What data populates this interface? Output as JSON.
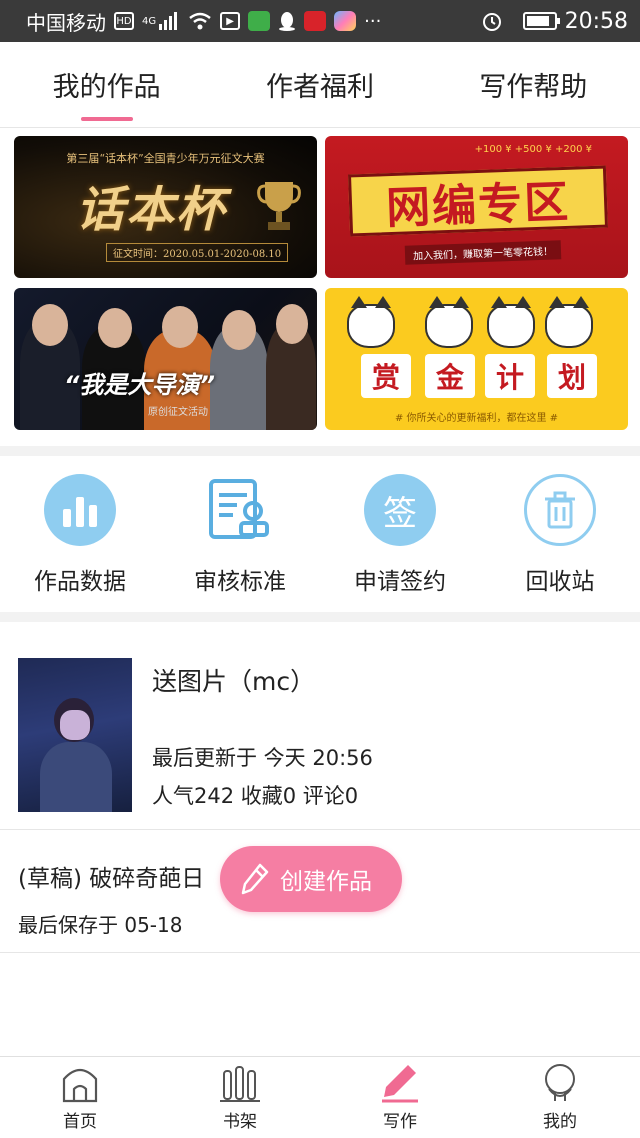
{
  "status_bar": {
    "carrier": "中国移动",
    "network": "4G",
    "hd": "HD",
    "time": "20:58",
    "icons": [
      "hd-icon",
      "signal-icon",
      "wifi-icon",
      "media-icon",
      "wechat-icon",
      "qq-icon",
      "app-icon",
      "app-icon",
      "more-icon",
      "alarm-icon",
      "battery-icon"
    ]
  },
  "tabs": [
    {
      "label": "我的作品",
      "active": true
    },
    {
      "label": "作者福利",
      "active": false
    },
    {
      "label": "写作帮助",
      "active": false
    }
  ],
  "banners": {
    "b1": {
      "headline": "第三届“话本杯”全国青少年万元征文大赛",
      "title": "话本杯",
      "date": "征文时间：2020.05.01-2020-08.10"
    },
    "b2": {
      "title": "网编专区",
      "money": "+100 ¥  +500 ¥  +200 ¥",
      "slogan": "加入我们，赚取第一笔零花钱！"
    },
    "b3": {
      "title": "“我是大导演”",
      "subtitle": "原创征文活动"
    },
    "b4": {
      "chars": [
        "赏",
        "金",
        "计",
        "划"
      ],
      "footer": "# 你所关心的更新福利，都在这里 #"
    }
  },
  "actions": [
    {
      "label": "作品数据",
      "icon": "bar-chart-icon"
    },
    {
      "label": "审核标准",
      "icon": "document-stamp-icon"
    },
    {
      "label": "申请签约",
      "icon": "sign-icon",
      "glyph": "签"
    },
    {
      "label": "回收站",
      "icon": "trash-icon"
    }
  ],
  "works": [
    {
      "title": "送图片（mc）",
      "updated": "最后更新于 今天 20:56",
      "stats": "人气242 收藏0 评论0"
    }
  ],
  "draft": {
    "title": "(草稿) 破碎奇葩日",
    "saved": "最后保存于 05-18"
  },
  "fab": {
    "label": "创建作品"
  },
  "bottom_nav": [
    {
      "label": "首页",
      "icon": "home-icon"
    },
    {
      "label": "书架",
      "icon": "bookshelf-icon"
    },
    {
      "label": "写作",
      "icon": "pen-icon",
      "active": true
    },
    {
      "label": "我的",
      "icon": "profile-icon"
    }
  ],
  "colors": {
    "accent": "#f06a92",
    "fab": "#f57ea3",
    "icon_blue": "#8fcdf0"
  }
}
